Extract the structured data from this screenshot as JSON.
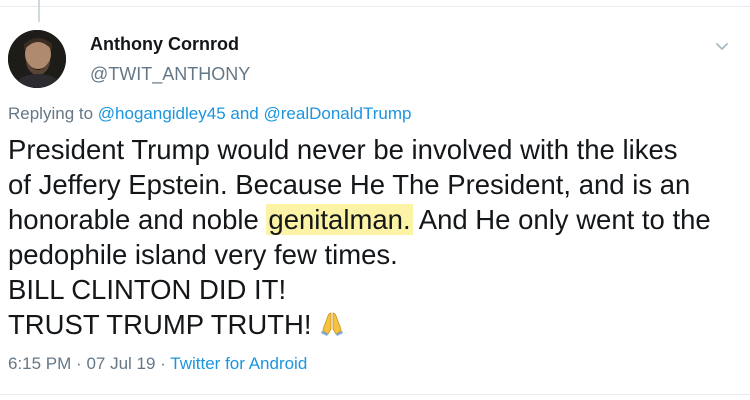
{
  "author": {
    "display_name": "Anthony Cornrod",
    "handle": "@TWIT_ANTHONY"
  },
  "reply": {
    "prefix": "Replying to",
    "mention_1": "@hogangidley45",
    "joiner": "and",
    "mention_2": "@realDonaldTrump"
  },
  "tweet": {
    "line_1": "President Trump would never be involved with the likes",
    "line_2": "of Jeffery Epstein. Because He The President, and is an",
    "line_3_before": "honorable and noble",
    "line_3_highlight": "genitalman.",
    "line_3_after": "And He only went to the",
    "line_4": "pedophile island very few times.",
    "line_5": "BILL CLINTON DID IT!",
    "line_6": "TRUST TRUMP TRUTH!"
  },
  "meta": {
    "time": "6:15 PM",
    "date": "07 Jul 19",
    "source": "Twitter for Android",
    "separator": "·"
  },
  "icons": {
    "menu": "chevron-down-icon",
    "emoji": "folded-hands-icon"
  },
  "colors": {
    "link": "#1b95e0",
    "secondary_text": "#657786",
    "primary_text": "#14171a",
    "highlight": "#fdf3a6"
  }
}
